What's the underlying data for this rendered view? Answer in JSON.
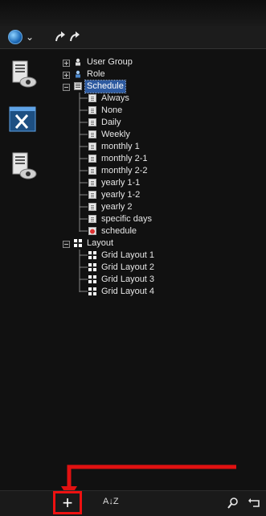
{
  "tree": {
    "root_items": [
      {
        "label": "User Group",
        "icon": "user-group-icon"
      },
      {
        "label": "Role",
        "icon": "role-icon"
      }
    ],
    "schedule": {
      "label": "Schedule",
      "children": [
        "Always",
        "None",
        "Daily",
        "Weekly",
        "monthly 1",
        "monthly 2-1",
        "monthly 2-2",
        "yearly 1-1",
        "yearly 1-2",
        "yearly 2",
        "specific days",
        "schedule"
      ]
    },
    "layout": {
      "label": "Layout",
      "children": [
        "Grid Layout 1",
        "Grid Layout 2",
        "Grid Layout 3",
        "Grid Layout 4"
      ]
    }
  },
  "bottom_toolbar": {
    "add_label": "+",
    "sort_label": "A↓Z"
  },
  "colors": {
    "highlight": "#e11111",
    "selection": "#2d5aa0"
  }
}
